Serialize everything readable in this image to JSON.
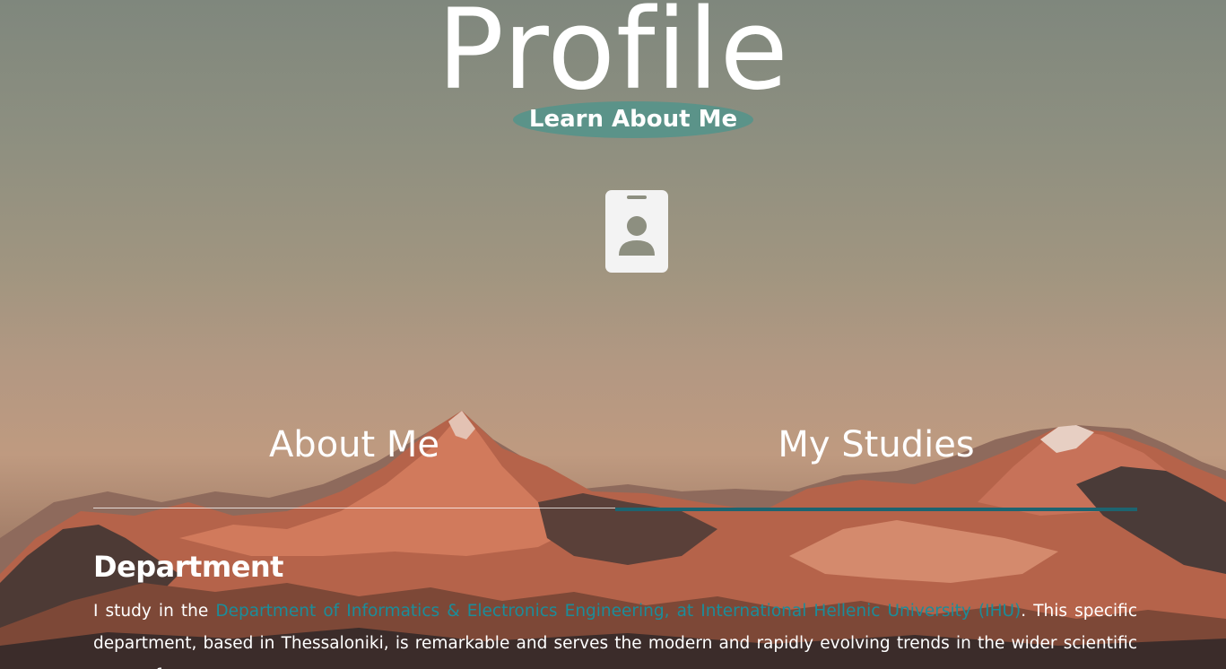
{
  "header": {
    "title": "Profile",
    "subtitle": "Learn About Me"
  },
  "icons": {
    "badge": "id-badge-icon"
  },
  "tabs": [
    {
      "label": "About Me",
      "active": false
    },
    {
      "label": "My Studies",
      "active": true
    }
  ],
  "section": {
    "heading": "Department",
    "text_before": "I study in the ",
    "link": "Department of Informatics & Electronics Engineering, at International Hellenic University (IHU)",
    "text_after": ". This specific department, based in Thessaloniki, is remarkable and serves the modern and rapidly evolving trends in the wider scientific areas of"
  },
  "colors": {
    "accent": "#5b9389",
    "active_tab": "#1d6470",
    "link": "#1b8d9a"
  }
}
